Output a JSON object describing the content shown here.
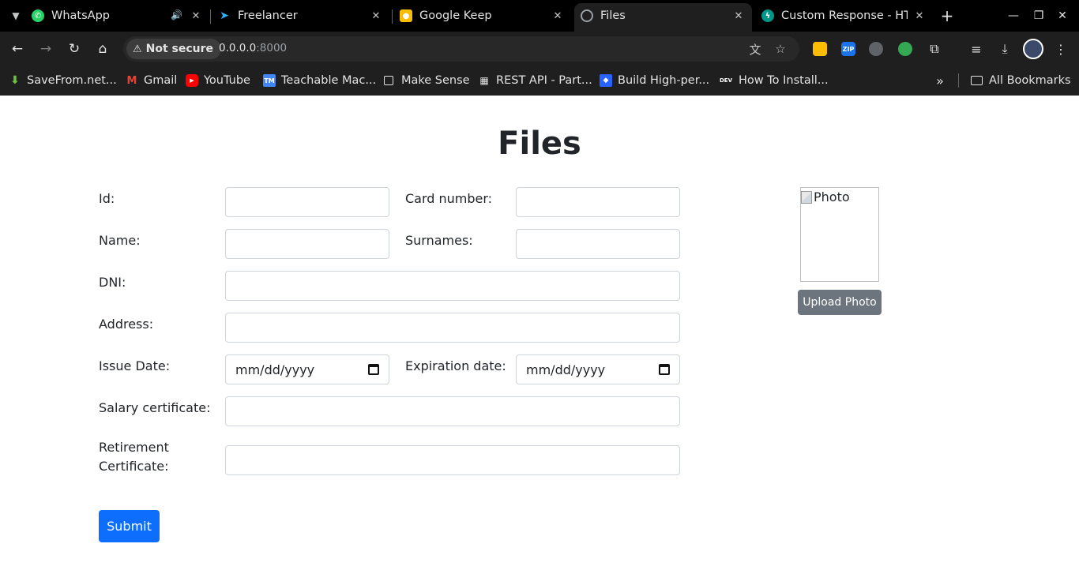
{
  "browser": {
    "tabs": [
      {
        "title": "WhatsApp",
        "icon": "whatsapp-icon",
        "icon_color": "#25d366",
        "audio": true
      },
      {
        "title": "Freelancer",
        "icon": "freelancer-icon",
        "icon_color": "#29b2fe"
      },
      {
        "title": "Google Keep",
        "icon": "keep-icon",
        "icon_color": "#fbbc04"
      },
      {
        "title": "Files",
        "icon": "globe-icon",
        "icon_color": "#9aa0a6",
        "active": true
      },
      {
        "title": "Custom Response - HTML",
        "icon": "fastapi-icon",
        "icon_color": "#009688"
      }
    ],
    "omnibox": {
      "security_label": "Not secure",
      "url_host": "0.0.0.0",
      "url_port": ":8000"
    },
    "bookmarks": [
      {
        "label": "SaveFrom.net...",
        "icon": "savefrom-icon",
        "icon_color": "#6ac43c"
      },
      {
        "label": "Gmail",
        "icon": "gmail-icon",
        "icon_color": "#ea4335"
      },
      {
        "label": "YouTube",
        "icon": "youtube-icon",
        "icon_color": "#ff0000"
      },
      {
        "label": "Teachable Mac...",
        "icon": "teachable-icon",
        "icon_color": "#4285f4"
      },
      {
        "label": "Make Sense",
        "icon": "makesense-icon",
        "icon_color": "#e3e3e3"
      },
      {
        "label": "REST API - Part...",
        "icon": "restapi-icon",
        "icon_color": "#e3e3e3"
      },
      {
        "label": "Build High-per...",
        "icon": "build-icon",
        "icon_color": "#2962ff"
      },
      {
        "label": "How To Install...",
        "icon": "dev-icon",
        "icon_color": "#ffffff"
      }
    ],
    "all_bookmarks_label": "All Bookmarks"
  },
  "page": {
    "title": "Files",
    "labels": {
      "id": "Id:",
      "card_number": "Card number:",
      "name": "Name:",
      "surnames": "Surnames:",
      "dni": "DNI:",
      "address": "Address:",
      "issue_date": "Issue Date:",
      "expiration_date": "Expiration date:",
      "salary_certificate": "Salary certificate:",
      "retirement_certificate_line1": "Retirement",
      "retirement_certificate_line2": "Certificate:"
    },
    "date_placeholder": "mm/dd/yyyy",
    "photo_alt": "Photo",
    "upload_button": "Upload Photo",
    "submit_button": "Submit",
    "colors": {
      "primary": "#0d6efd",
      "secondary": "#6c757d"
    }
  }
}
